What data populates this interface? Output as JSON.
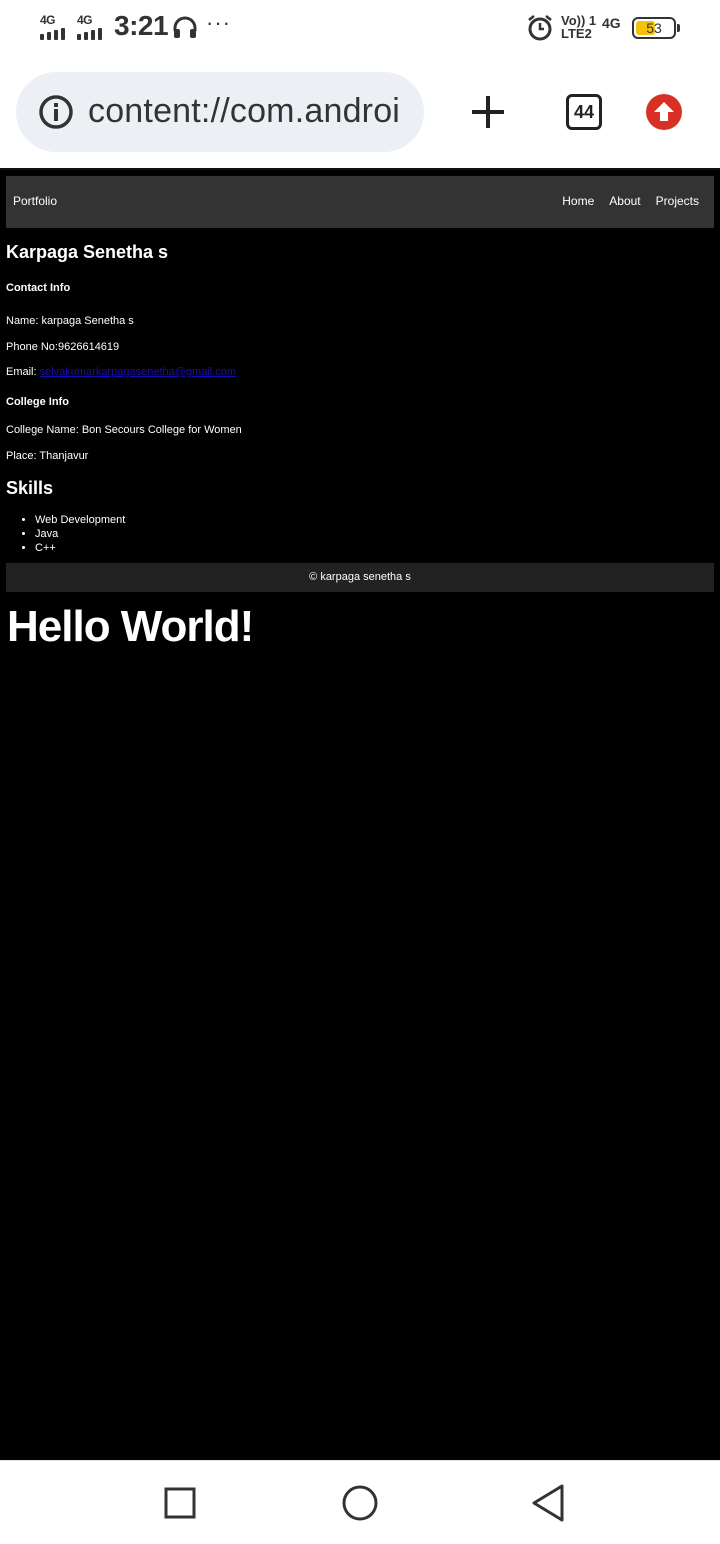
{
  "status_bar": {
    "sim1_label": "4G",
    "sim2_label": "4G",
    "time": "3:21",
    "dots": "···",
    "volte_line1": "Vo)) 1",
    "volte_line2": "LTE2",
    "net_label": "4G",
    "battery_percent": "53",
    "battery_level": 0.53,
    "battery_color": "#f4c20d",
    "icons": [
      "signal-icon",
      "headset-icon",
      "alarm-icon",
      "battery-icon"
    ]
  },
  "browser": {
    "url": "content://com.androi",
    "tab_count": "44",
    "upgrade_color": "#d93025"
  },
  "site": {
    "nav": {
      "brand": "Portfolio",
      "links": [
        "Home",
        "About",
        "Projects"
      ]
    },
    "name_heading": "Karpaga Senetha s",
    "contact_heading": "Contact Info",
    "name_line": "Name: karpaga Senetha s",
    "phone_line": "Phone No:9626614619",
    "email_label": "Email: ",
    "email_link": "selvakumarkarpagasenetha@gmail.com",
    "college_heading": "College Info",
    "college_line": "College Name: Bon Secours College for Women",
    "place_line": "Place: Thanjavur",
    "skills_heading": "Skills",
    "skills": [
      "Web Development",
      "Java",
      "C++"
    ],
    "footer": "© karpaga senetha s",
    "hello": "Hello World!"
  },
  "colors": {
    "page_bg": "#000000",
    "nav_bg": "#333333",
    "footer_bg": "#222222",
    "link": "#1a0dab"
  }
}
